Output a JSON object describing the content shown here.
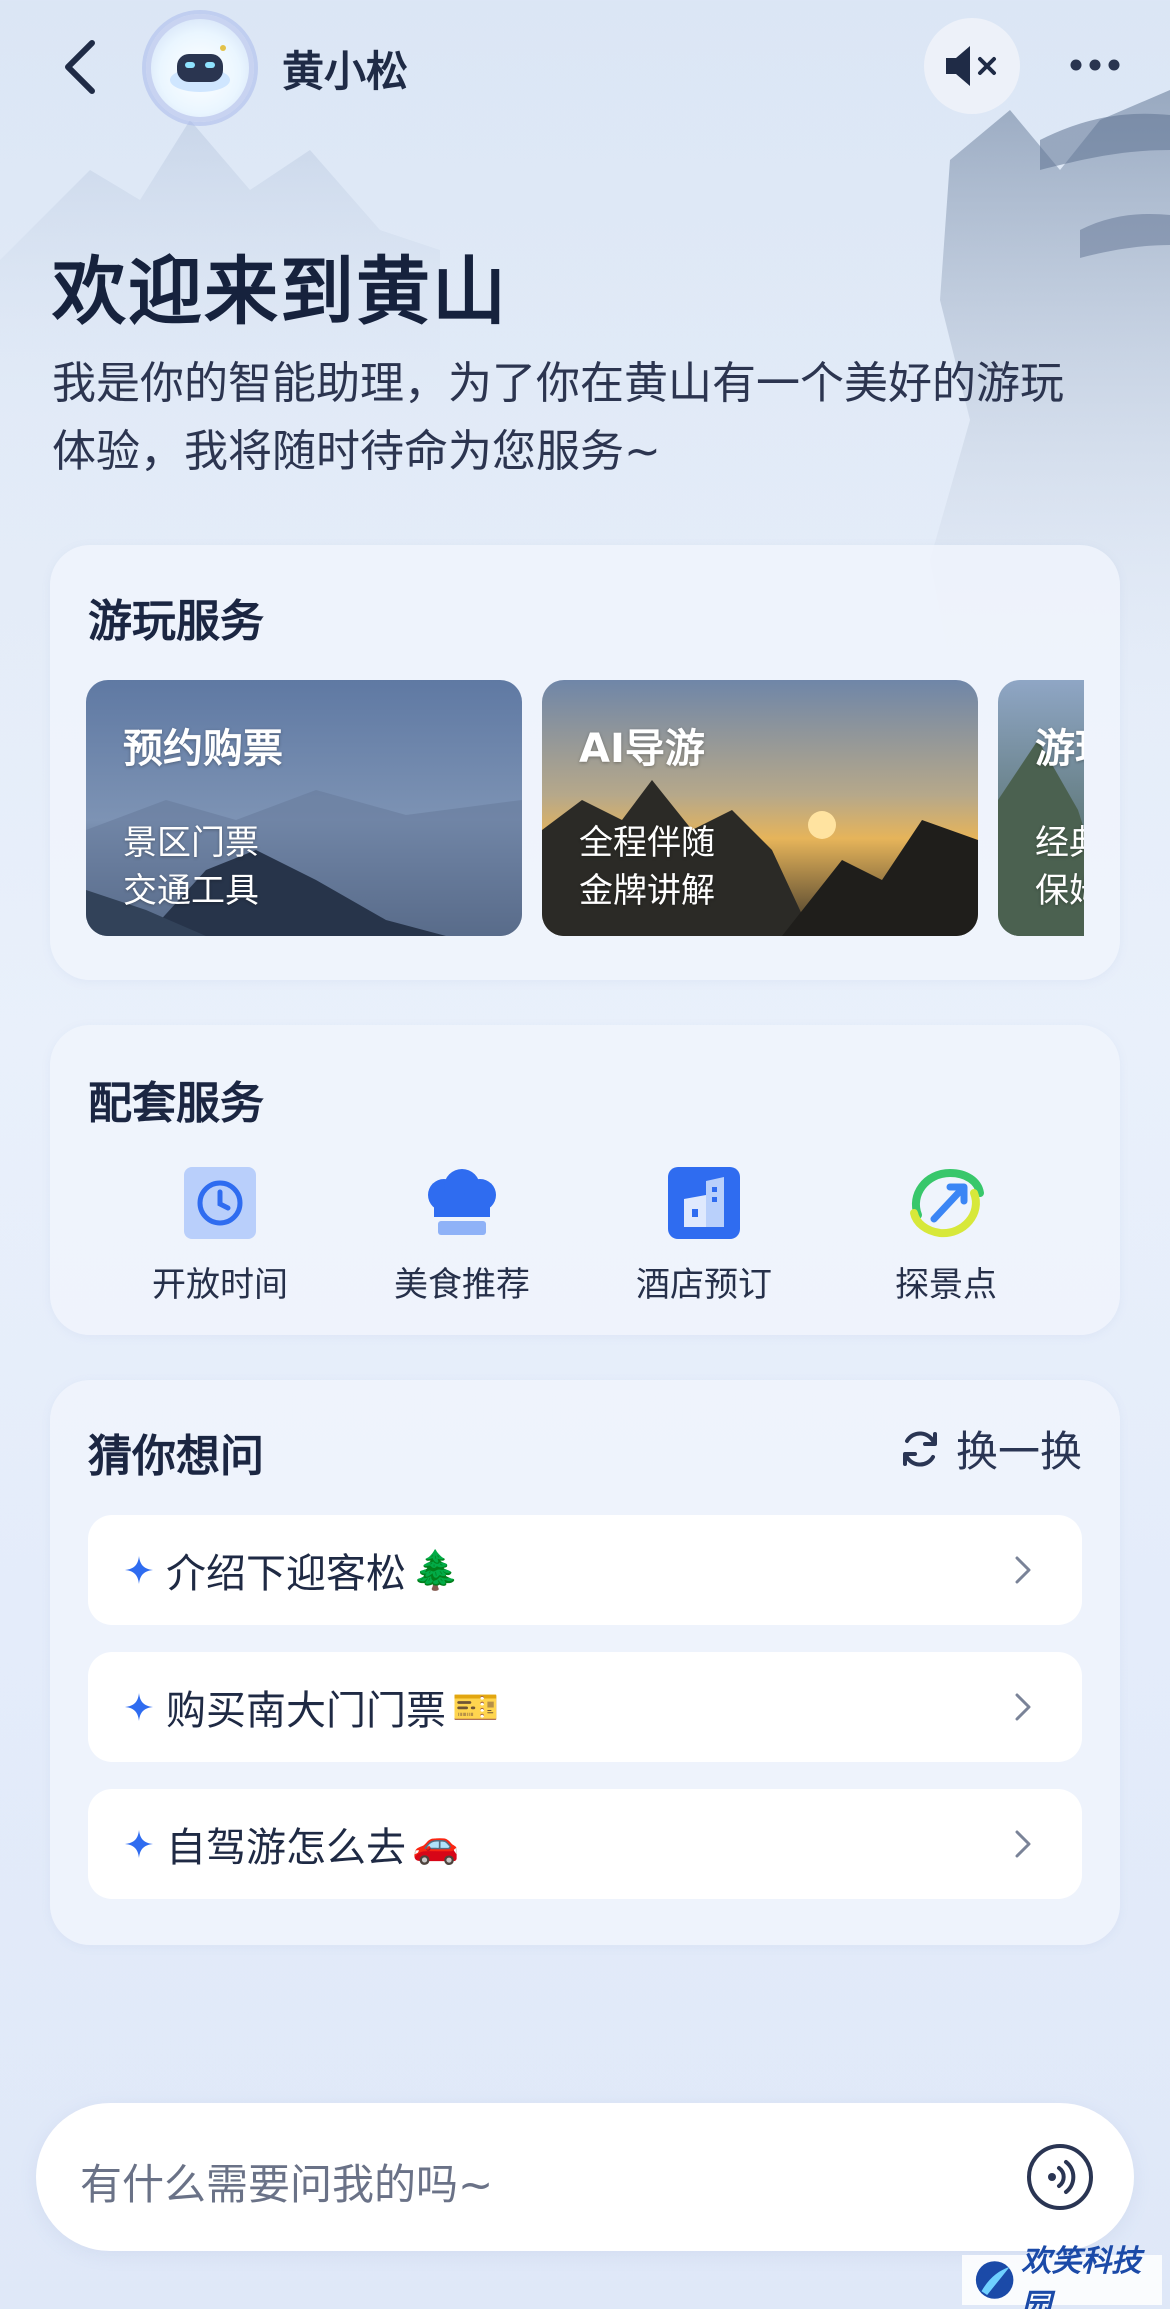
{
  "header": {
    "bot_name": "黄小松"
  },
  "welcome": {
    "title": "欢迎来到黄山",
    "description": "我是你的智能助理，为了你在黄山有一个美好的游玩体验，我将随时待命为您服务~"
  },
  "play_services": {
    "title": "游玩服务",
    "tiles": [
      {
        "title": "预约购票",
        "lines": [
          "景区门票",
          "交通工具"
        ]
      },
      {
        "title": "AI导游",
        "lines": [
          "全程伴随",
          "金牌讲解"
        ]
      },
      {
        "title": "游玩",
        "lines": [
          "经典",
          "保姆"
        ]
      }
    ]
  },
  "support_services": {
    "title": "配套服务",
    "items": [
      {
        "label": "开放时间",
        "icon": "clock-icon"
      },
      {
        "label": "美食推荐",
        "icon": "chef-hat-icon"
      },
      {
        "label": "酒店预订",
        "icon": "hotel-icon"
      },
      {
        "label": "探景点",
        "icon": "explore-icon"
      }
    ]
  },
  "guess": {
    "title": "猜你想问",
    "refresh_label": "换一换",
    "questions": [
      {
        "text": "介绍下迎客松",
        "emoji": "🌲"
      },
      {
        "text": "购买南大门门票",
        "emoji": "🎫"
      },
      {
        "text": "自驾游怎么去",
        "emoji": "🚗"
      }
    ]
  },
  "input": {
    "placeholder": "有什么需要问我的吗~"
  },
  "watermark": {
    "text": "欢笑科技园"
  },
  "colors": {
    "accent_blue": "#2f6cf0",
    "text_dark": "#1d2b47",
    "bg": "#e6eef9"
  }
}
